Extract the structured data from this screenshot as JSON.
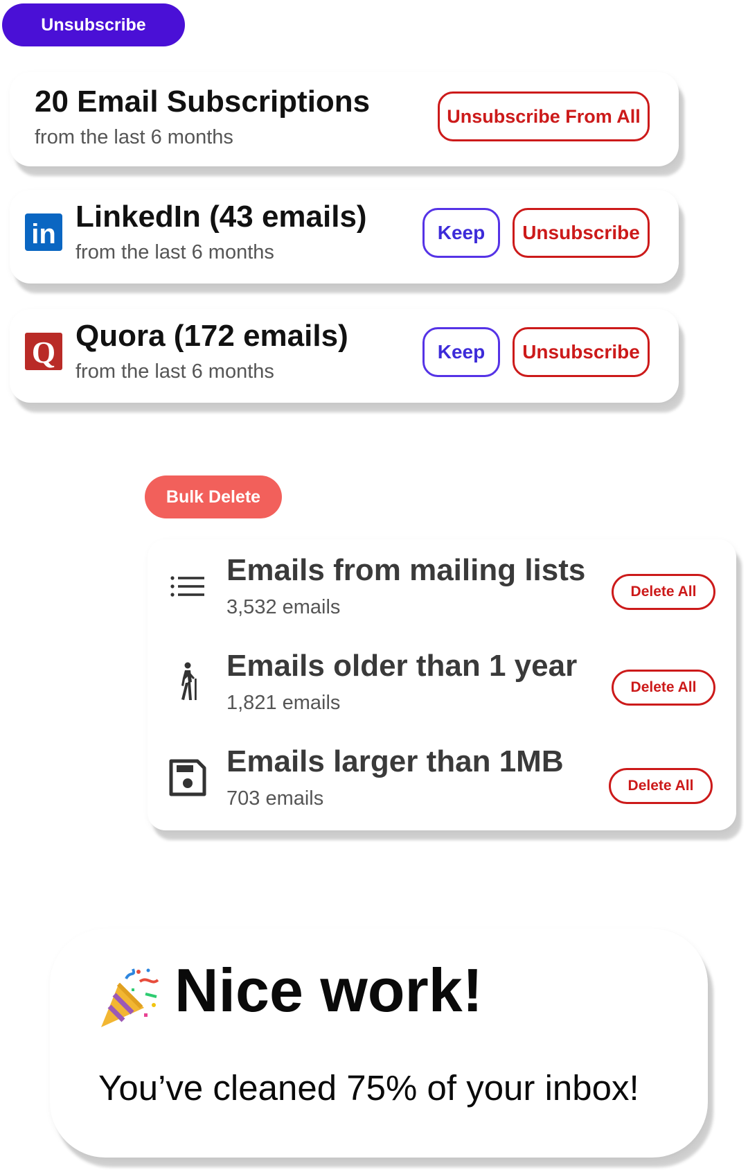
{
  "unsubscribe_section": {
    "pill_label": "Unsubscribe",
    "summary": {
      "title": "20 Email Subscriptions",
      "subtitle": "from the last 6 months",
      "unsubscribe_all_label": "Unsubscribe From All"
    },
    "senders": [
      {
        "name_count": "LinkedIn (43 emails)",
        "subtitle": "from the last 6 months",
        "keep_label": "Keep",
        "unsubscribe_label": "Unsubscribe",
        "icon": "linkedin-icon",
        "brand_color": "#0a66c2",
        "logo_text": "in"
      },
      {
        "name_count": "Quora (172 emails)",
        "subtitle": "from the last 6 months",
        "keep_label": "Keep",
        "unsubscribe_label": "Unsubscribe",
        "icon": "quora-icon",
        "brand_color": "#b92b27",
        "logo_text": "Q"
      }
    ]
  },
  "bulk_delete_section": {
    "pill_label": "Bulk Delete",
    "rows": [
      {
        "title": "Emails from mailing lists",
        "count": "3,532 emails",
        "action_label": "Delete All",
        "icon": "list-icon"
      },
      {
        "title": "Emails older than 1 year",
        "count": "1,821 emails",
        "action_label": "Delete All",
        "icon": "elderly-person-icon"
      },
      {
        "title": "Emails larger than 1MB",
        "count": "703 emails",
        "action_label": "Delete All",
        "icon": "save-icon"
      }
    ]
  },
  "completion": {
    "title": "Nice work!",
    "message": "You’ve cleaned 75% of your inbox!",
    "icon": "party-popper-icon"
  },
  "colors": {
    "unsubscribe_pill": "#4a10d6",
    "bulk_delete_pill": "#f2605b",
    "danger": "#cc1a1a",
    "keep": "#5533e6"
  }
}
